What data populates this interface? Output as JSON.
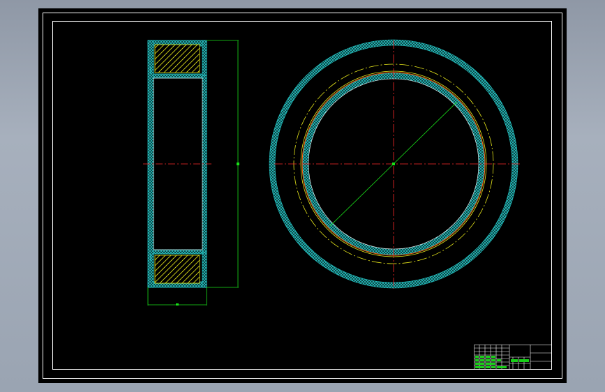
{
  "colors": {
    "background_viewport": "#9aa4b2",
    "sheet": "#000000",
    "frame": "#ffffff",
    "centerline": "#ff2a2a",
    "dimension": "#19e019",
    "hatch": "#1fbcbc",
    "pitch_circle": "#e6e61a",
    "gear_edge": "#ff6a1a",
    "title_block": "#ffffff",
    "title_block_fill": "#18d018"
  },
  "drawing": {
    "side_view": "gear-ring-section",
    "front_view": "gear-ring-face",
    "title_block": "title-block-table"
  }
}
